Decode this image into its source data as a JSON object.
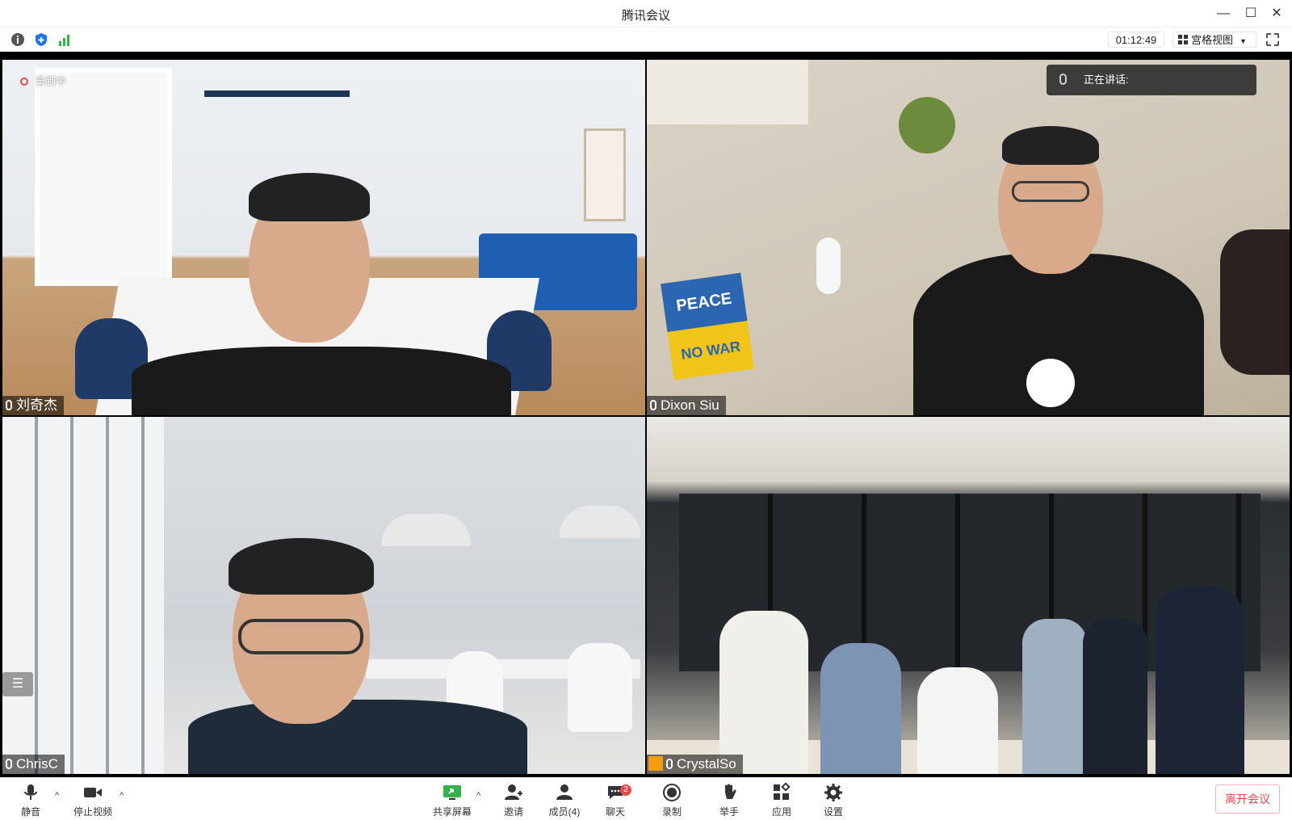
{
  "window": {
    "title": "腾讯会议"
  },
  "topbar": {
    "timer": "01:12:49",
    "view_mode": "宫格视图",
    "icons": [
      "info-icon",
      "shield-icon",
      "signal-icon",
      "fullscreen-icon"
    ]
  },
  "status": {
    "recording": "录制中",
    "speaking_label": "正在讲话:"
  },
  "participants": [
    {
      "name": "刘奇杰"
    },
    {
      "name": "Dixon Siu"
    },
    {
      "name": "ChrisC"
    },
    {
      "name": "CrystalSo"
    }
  ],
  "scene_text": {
    "sign_line1": "PEACE",
    "sign_line2": "NO WAR"
  },
  "controls": {
    "mute": "静音",
    "stop_video": "停止视频",
    "share_screen": "共享屏幕",
    "invite": "邀请",
    "members": "成员(4)",
    "chat": "聊天",
    "chat_badge": "2",
    "record": "录制",
    "raise_hand": "举手",
    "apps": "应用",
    "settings": "设置",
    "leave": "离开会议"
  },
  "colors": {
    "accent_blue": "#1a73e8",
    "leave_red": "#e24a4a",
    "signal_green": "#2fb34a"
  }
}
